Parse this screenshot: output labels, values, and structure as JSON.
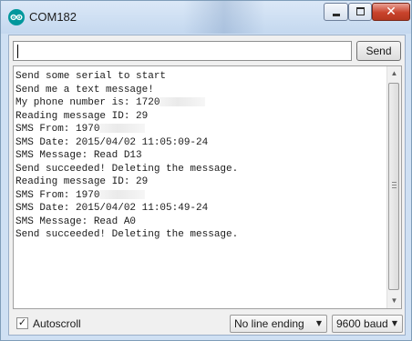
{
  "window": {
    "title": "COM182",
    "controls": {
      "minimize": "minimize",
      "maximize": "maximize",
      "close": "✕"
    }
  },
  "send_bar": {
    "input_value": "",
    "send_label": "Send"
  },
  "serial_output": {
    "lines": [
      "Send some serial to start",
      "Send me a text message!",
      "My phone number is: 1720",
      "Reading message ID: 29",
      "SMS From: 1970",
      "SMS Date: 2015/04/02 11:05:09-24",
      "SMS Message: Read D13",
      "Send succeeded! Deleting the message.",
      "Reading message ID: 29",
      "SMS From: 1970",
      "SMS Date: 2015/04/02 11:05:49-24",
      "SMS Message: Read A0",
      "Send succeeded! Deleting the message."
    ],
    "redacted_line_indexes": [
      2,
      4,
      9
    ]
  },
  "statusbar": {
    "autoscroll_label": "Autoscroll",
    "autoscroll_checked": true,
    "line_ending": "No line ending",
    "baud_rate": "9600 baud"
  },
  "icons": {
    "app": "arduino-icon",
    "scroll_up": "▲",
    "scroll_down": "▼",
    "dropdown_arrow": "▼",
    "check": "✓"
  },
  "colors": {
    "titlebar": "#c4d8ef",
    "close_button": "#c9432c",
    "arduino_teal": "#00979c"
  }
}
